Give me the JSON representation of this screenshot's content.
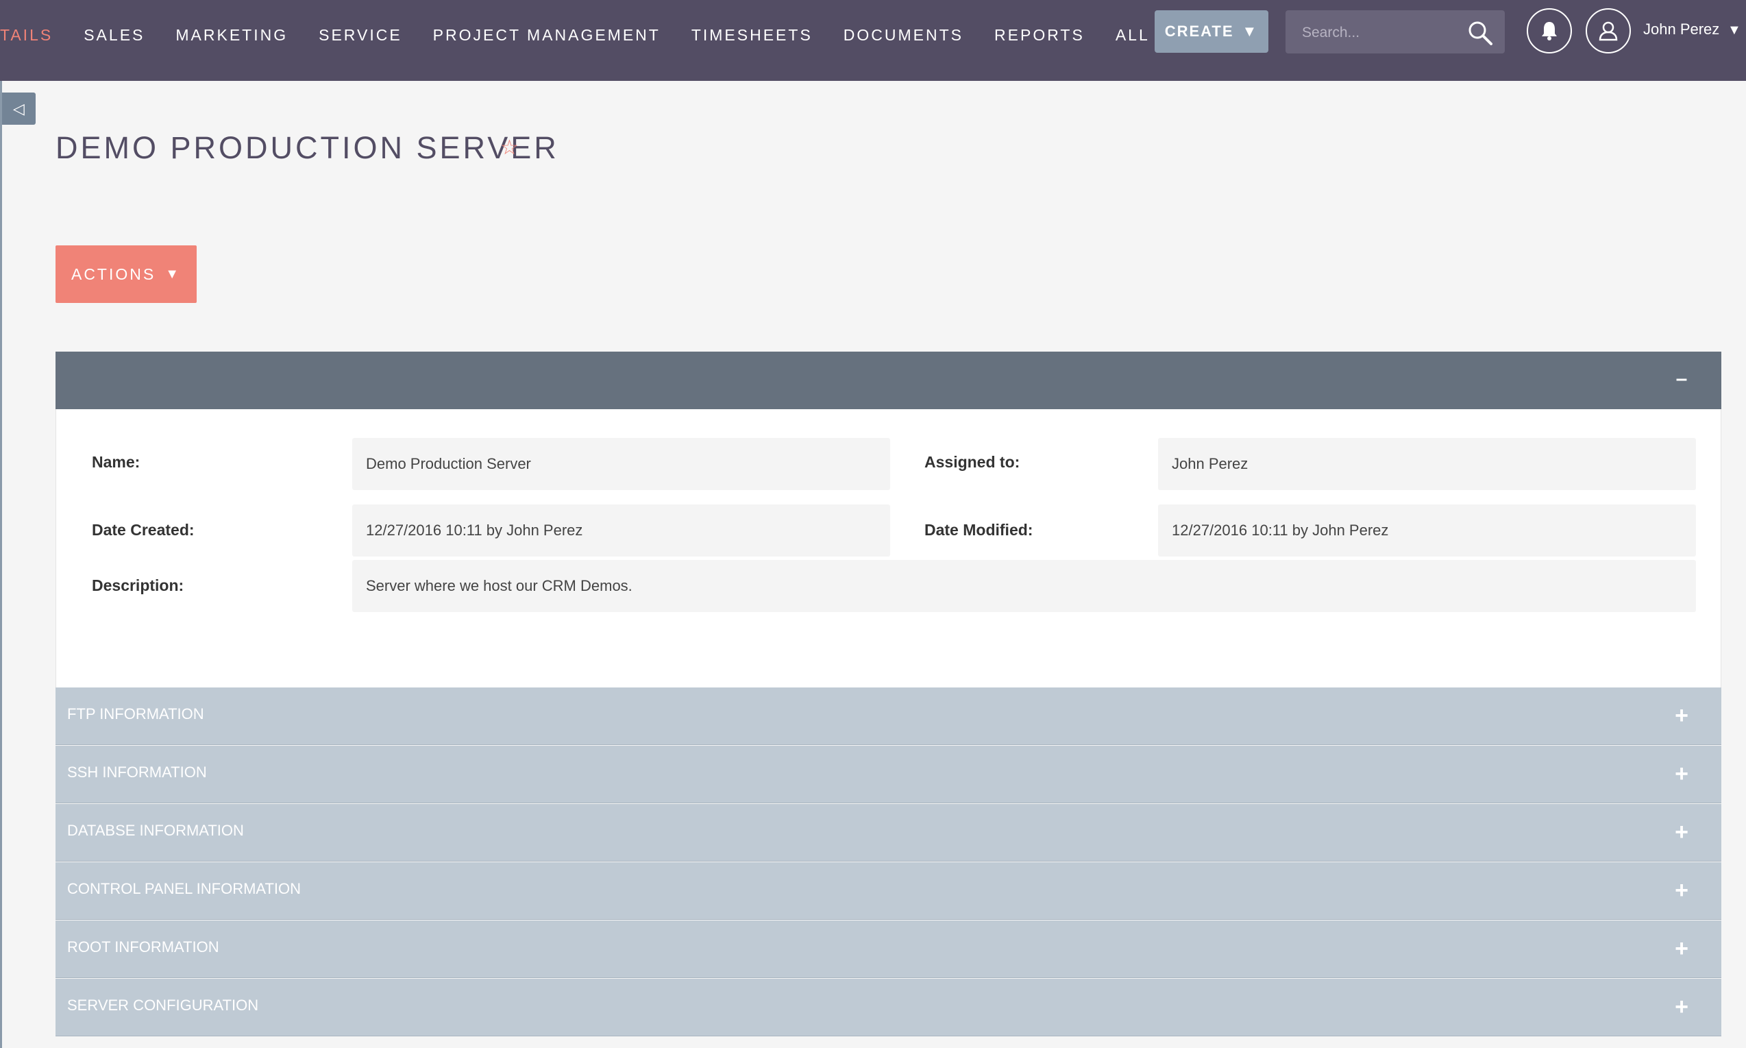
{
  "nav": {
    "items": [
      {
        "label": "TAILS",
        "active": true
      },
      {
        "label": "SALES"
      },
      {
        "label": "MARKETING"
      },
      {
        "label": "SERVICE"
      },
      {
        "label": "PROJECT MANAGEMENT"
      },
      {
        "label": "TIMESHEETS"
      },
      {
        "label": "DOCUMENTS"
      },
      {
        "label": "REPORTS"
      },
      {
        "label": "ALL"
      }
    ],
    "create_label": "CREATE",
    "search_placeholder": "Search...",
    "user_name": "John Perez"
  },
  "icons": {
    "sidebar_toggle": "triangle-left-icon",
    "search": "search-icon",
    "notifications": "bell-icon",
    "user": "user-icon",
    "favorite": "star-icon"
  },
  "colors": {
    "topbar": "#534d64",
    "accent": "#f08377",
    "panel_header": "#66717e",
    "subpanel": "#bfcad4"
  },
  "page": {
    "title": "DEMO PRODUCTION SERVER",
    "actions_label": "ACTIONS"
  },
  "detail": {
    "name_label": "Name:",
    "name_value": "Demo Production Server",
    "assigned_label": "Assigned to:",
    "assigned_value": "John Perez",
    "created_label": "Date Created:",
    "created_value": "12/27/2016 10:11 by John Perez",
    "modified_label": "Date Modified:",
    "modified_value": "12/27/2016 10:11 by John Perez",
    "description_label": "Description:",
    "description_value": "Server where we host our CRM Demos."
  },
  "panels": [
    {
      "title": "FTP INFORMATION"
    },
    {
      "title": "SSH INFORMATION"
    },
    {
      "title": "DATABSE INFORMATION"
    },
    {
      "title": "CONTROL PANEL INFORMATION"
    },
    {
      "title": "ROOT INFORMATION"
    },
    {
      "title": "SERVER CONFIGURATION"
    }
  ]
}
